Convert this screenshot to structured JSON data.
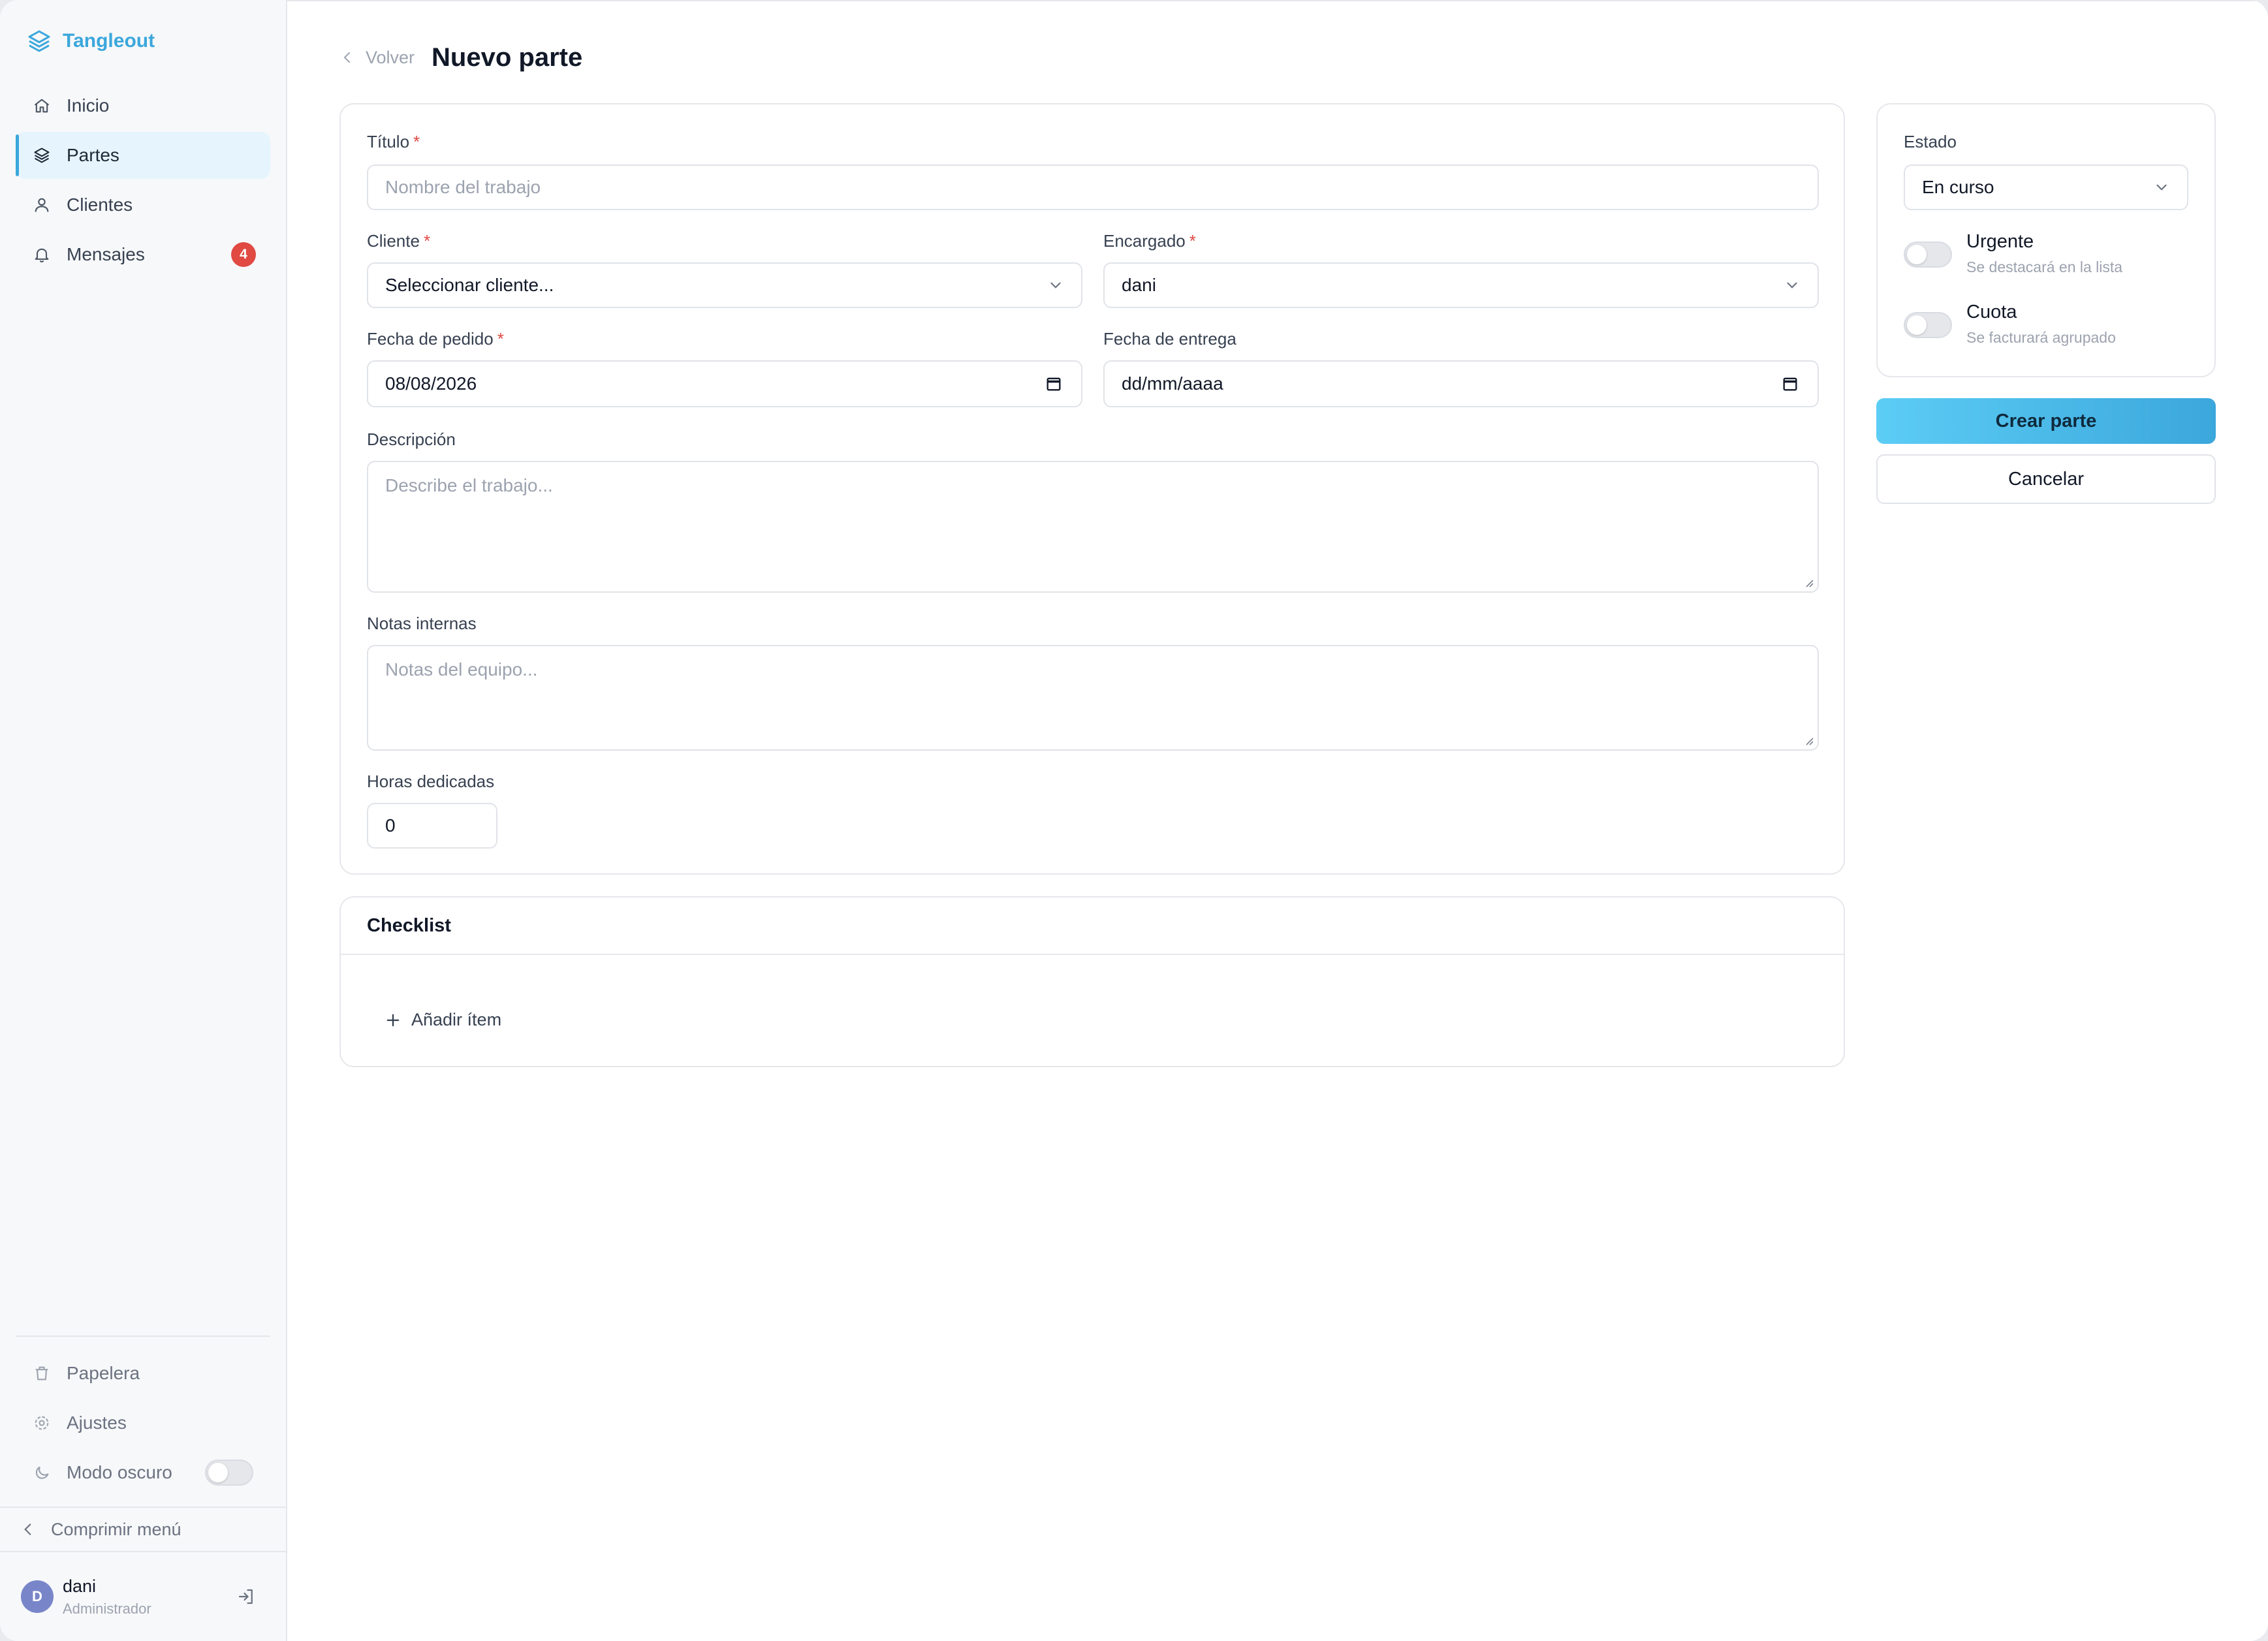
{
  "brand": {
    "name": "Tangleout",
    "color": "#3ba7dc",
    "icon": "layers-icon"
  },
  "sidebar": {
    "items": [
      {
        "label": "Inicio",
        "icon": "home-icon",
        "active": false
      },
      {
        "label": "Partes",
        "icon": "layers-icon",
        "active": true
      },
      {
        "label": "Clientes",
        "icon": "user-icon",
        "active": false
      },
      {
        "label": "Mensajes",
        "icon": "bell-icon",
        "active": false,
        "badge": "4"
      }
    ],
    "bottom_items": [
      {
        "label": "Papelera",
        "icon": "trash-icon"
      },
      {
        "label": "Ajustes",
        "icon": "gear-icon"
      },
      {
        "label": "Modo oscuro",
        "icon": "moon-icon",
        "toggle": false
      }
    ],
    "collapse_label": "Comprimir menú",
    "user": {
      "initial": "D",
      "name": "dani",
      "role": "Administrador"
    }
  },
  "header": {
    "back_label": "Volver",
    "title": "Nuevo parte"
  },
  "form": {
    "titulo": {
      "label": "Título",
      "placeholder": "Nombre del trabajo"
    },
    "cliente": {
      "label": "Cliente",
      "value": "Seleccionar cliente..."
    },
    "encargado": {
      "label": "Encargado",
      "value": "dani"
    },
    "fecha_pedido": {
      "label": "Fecha de pedido",
      "value": "08/08/2026"
    },
    "fecha_entrega": {
      "label": "Fecha de entrega",
      "value": "dd/mm/aaaa"
    },
    "descripcion": {
      "label": "Descripción",
      "placeholder": "Describe el trabajo..."
    },
    "notas": {
      "label": "Notas internas",
      "placeholder": "Notas del equipo..."
    },
    "horas": {
      "label": "Horas dedicadas",
      "value": "0"
    },
    "required_mark": "*"
  },
  "side": {
    "estado_label": "Estado",
    "estado_value": "En curso",
    "urgente": {
      "title": "Urgente",
      "sub": "Se destacará en la lista",
      "on": false
    },
    "cuota": {
      "title": "Cuota",
      "sub": "Se facturará agrupado",
      "on": false
    }
  },
  "actions": {
    "create": "Crear parte",
    "cancel": "Cancelar"
  },
  "checklist": {
    "title": "Checklist",
    "add_label": "Añadir ítem"
  },
  "colors": {
    "accent": "#3ba7dc",
    "badge": "#e04a43",
    "required": "#e04a43"
  }
}
